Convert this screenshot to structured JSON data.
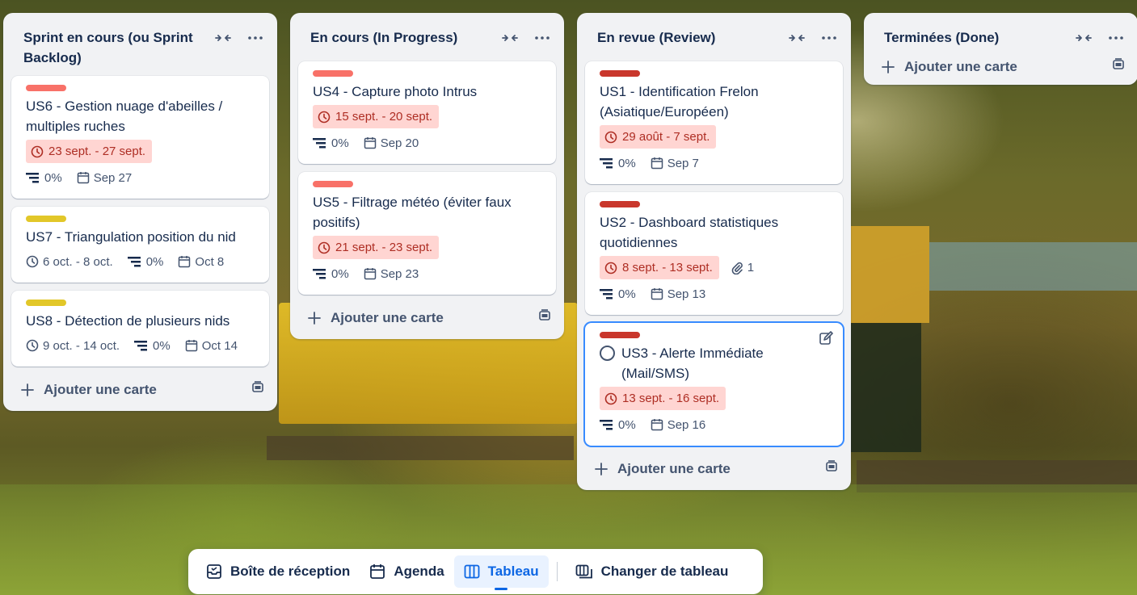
{
  "colors": {
    "label_salmon": "#f87168",
    "label_yellow": "#e2c729",
    "label_red": "#c9372c",
    "overdue_bg": "#ffd5d2",
    "overdue_text": "#ae2e24",
    "accent_blue": "#0c66e4"
  },
  "lists": [
    {
      "title": "Sprint en cours (ou Sprint Backlog)",
      "collapse_icon": "collapse-icon",
      "menu_icon": "more-icon",
      "add_card_label": "Ajouter une carte",
      "cards": [
        {
          "label_color": "salmon",
          "title": "US6 - Gestion nuage d'abeilles / multiples ruches",
          "dates": "23 sept. - 27 sept.",
          "overdue": true,
          "checklist": "0%",
          "due": "Sep 27"
        },
        {
          "label_color": "yellow",
          "title": "US7 - Triangulation position du nid",
          "dates": "6 oct. - 8 oct.",
          "overdue": false,
          "checklist": "0%",
          "due": "Oct 8"
        },
        {
          "label_color": "yellow",
          "title": "US8 - Détection de plusieurs nids",
          "dates": "9 oct. - 14 oct.",
          "overdue": false,
          "checklist": "0%",
          "due": "Oct 14"
        }
      ]
    },
    {
      "title": "En cours (In Progress)",
      "collapse_icon": "collapse-icon",
      "menu_icon": "more-icon",
      "add_card_label": "Ajouter une carte",
      "cards": [
        {
          "label_color": "salmon",
          "title": "US4 - Capture photo Intrus",
          "dates": "15 sept. - 20 sept.",
          "overdue": true,
          "checklist": "0%",
          "due": "Sep 20"
        },
        {
          "label_color": "salmon",
          "title": "US5 - Filtrage météo (éviter faux positifs)",
          "dates": "21 sept. - 23 sept.",
          "overdue": true,
          "checklist": "0%",
          "due": "Sep 23"
        }
      ]
    },
    {
      "title": "En revue (Review)",
      "collapse_icon": "collapse-icon",
      "menu_icon": "more-icon",
      "add_card_label": "Ajouter une carte",
      "cards": [
        {
          "label_color": "red",
          "title": "US1 - Identification Frelon (Asiatique/Européen)",
          "dates": "29 août - 7 sept.",
          "overdue": true,
          "checklist": "0%",
          "due": "Sep 7"
        },
        {
          "label_color": "red",
          "title": "US2 - Dashboard statistiques quotidiennes",
          "dates": "8 sept. - 13 sept.",
          "overdue": true,
          "attachments": "1",
          "checklist": "0%",
          "due": "Sep 13"
        },
        {
          "label_color": "red",
          "title": "US3 - Alerte Immédiate (Mail/SMS)",
          "dates": "13 sept. - 16 sept.",
          "overdue": true,
          "checklist": "0%",
          "due": "Sep 16",
          "focused": true
        }
      ]
    },
    {
      "title": "Terminées (Done)",
      "collapse_icon": "collapse-icon",
      "menu_icon": "more-icon",
      "add_card_label": "Ajouter une carte",
      "cards": []
    }
  ],
  "bottom_nav": {
    "inbox": "Boîte de réception",
    "planner": "Agenda",
    "board": "Tableau",
    "switch_board": "Changer de tableau"
  }
}
